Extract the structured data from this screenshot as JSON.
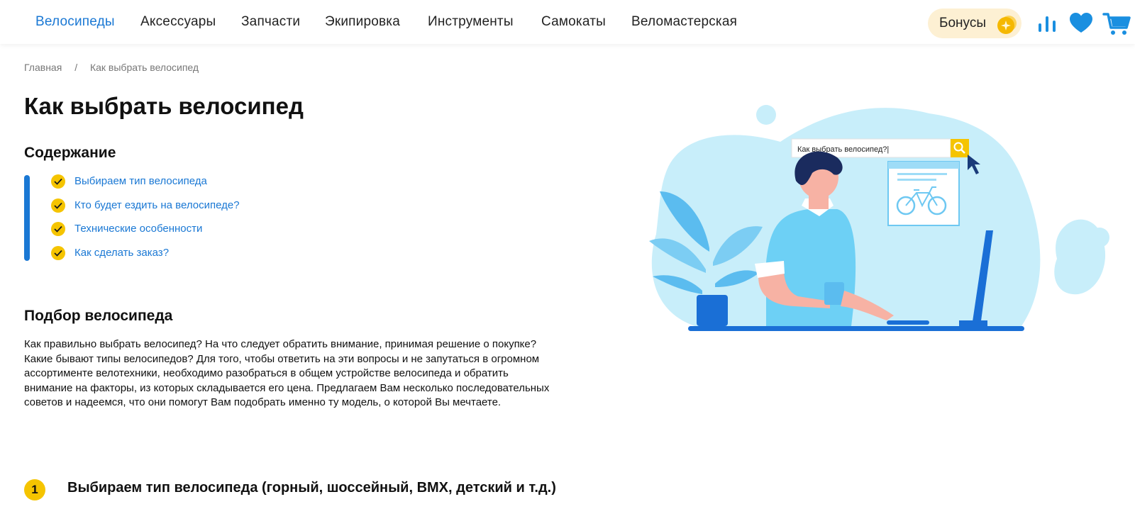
{
  "nav": {
    "items": [
      {
        "label": "Велосипеды",
        "active": true
      },
      {
        "label": "Аксессуары"
      },
      {
        "label": "Запчасти"
      },
      {
        "label": "Экипировка"
      },
      {
        "label": "Инструменты"
      },
      {
        "label": "Самокаты"
      },
      {
        "label": "Веломастерская"
      }
    ],
    "bonus_label": "Бонусы",
    "icons": [
      "compare-icon",
      "heart-icon",
      "cart-icon"
    ]
  },
  "breadcrumb": {
    "home": "Главная",
    "separator": "/",
    "current": "Как выбрать велосипед"
  },
  "page": {
    "title": "Как выбрать велосипед"
  },
  "toc": {
    "title": "Содержание",
    "items": [
      "Выбираем тип велосипеда",
      "Кто будет ездить на велосипеде?",
      "Технические особенности",
      "Как сделать заказ?"
    ]
  },
  "section": {
    "title": "Подбор велосипеда",
    "text": "Как правильно выбрать велосипед? На что следует обратить внимание, принимая решение о покупке? Какие бывают типы велосипедов? Для того, чтобы ответить на эти вопросы и не запутаться в огромном ассортименте велотехники, необходимо разобраться в общем устройстве велосипеда и обратить внимание на факторы, из которых складывается его цена. Предлагаем Вам несколько последовательных советов и надеемся, что они помогут Вам подобрать именно ту модель, о которой Вы мечтаете."
  },
  "step": {
    "number": "1",
    "title": "Выбираем тип велосипеда (горный, шоссейный, BMX, детский и т.д.)"
  },
  "illustration": {
    "search_text": "Как выбрать велосипед?|"
  },
  "colors": {
    "accent": "#1a78d4",
    "yellow": "#f5c400",
    "bonus_bg": "#fdf0d3",
    "light_blue": "#c8eefa"
  }
}
